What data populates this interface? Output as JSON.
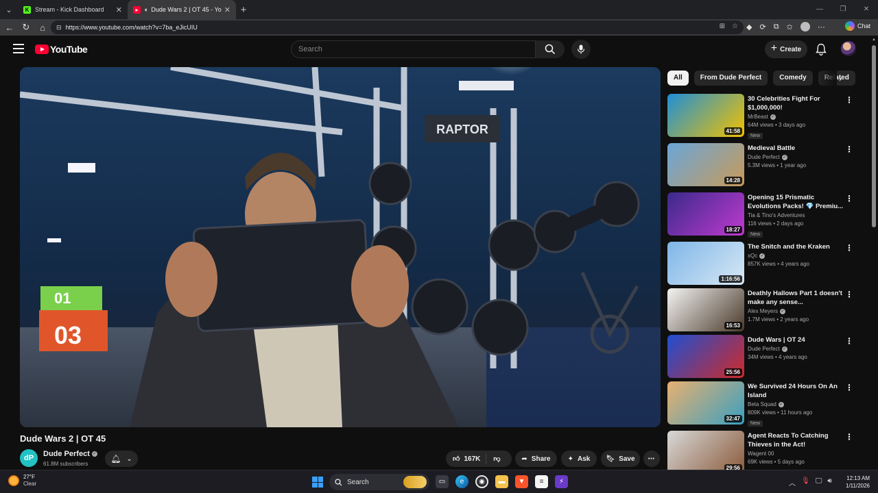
{
  "browser": {
    "tabs": [
      {
        "title": "Stream - Kick Dashboard",
        "favicon": "kick-icon",
        "active": false
      },
      {
        "title": "Dude Wars 2 | OT 45 - YouTube",
        "favicon": "youtube-icon",
        "active": true
      }
    ],
    "url": "https://www.youtube.com/watch?v=7ba_eJicUIU",
    "chat_label": "Chat"
  },
  "masthead": {
    "logo_text": "YouTube",
    "search_placeholder": "Search",
    "create_label": "Create"
  },
  "video": {
    "title": "Dude Wars 2 | OT 45",
    "channel": "Dude Perfect",
    "subscribers": "61.8M subscribers",
    "likes": "167K",
    "share_label": "Share",
    "ask_label": "Ask",
    "save_label": "Save"
  },
  "chips": [
    "All",
    "From Dude Perfect",
    "Comedy",
    "Related"
  ],
  "recommendations": [
    {
      "title": "30 Celebrities Fight For $1,000,000!",
      "channel": "MrBeast",
      "verified": true,
      "meta": "64M views • 3 days ago",
      "duration": "41:58",
      "is_new": true,
      "new_label": "New",
      "thumb_colors": [
        "#1f8fd6",
        "#f2c200"
      ]
    },
    {
      "title": "Medieval Battle",
      "channel": "Dude Perfect",
      "verified": true,
      "meta": "5.3M views • 1 year ago",
      "duration": "14:28",
      "is_new": false,
      "new_label": "",
      "thumb_colors": [
        "#6aa6d8",
        "#c89a5a"
      ]
    },
    {
      "title": "Opening 15 Prismatic Evolutions Packs! 💎 Premiu...",
      "channel": "Tia & Tino's Adventures",
      "verified": false,
      "meta": "116 views • 2 days ago",
      "duration": "18:27",
      "is_new": true,
      "new_label": "New",
      "thumb_colors": [
        "#3a2a8a",
        "#c03ad0"
      ]
    },
    {
      "title": "The Snitch and the Kraken",
      "channel": "xQc",
      "verified": true,
      "meta": "857K views • 4 years ago",
      "duration": "1:16:56",
      "is_new": false,
      "new_label": "",
      "thumb_colors": [
        "#7fb6e8",
        "#d8e8f5"
      ]
    },
    {
      "title": "Deathly Hallows Part 1 doesn't make any sense...",
      "channel": "Alex Meyers",
      "verified": true,
      "meta": "1.7M views • 2 years ago",
      "duration": "16:53",
      "is_new": false,
      "new_label": "",
      "thumb_colors": [
        "#f4f4f4",
        "#4a3a2a"
      ]
    },
    {
      "title": "Dude Wars | OT 24",
      "channel": "Dude Perfect",
      "verified": true,
      "meta": "34M views • 4 years ago",
      "duration": "25:56",
      "is_new": false,
      "new_label": "",
      "thumb_colors": [
        "#1e4fd0",
        "#d02a2a"
      ]
    },
    {
      "title": "We Survived 24 Hours On An Island",
      "channel": "Beta Squad",
      "verified": true,
      "meta": "809K views • 11 hours ago",
      "duration": "32:47",
      "is_new": true,
      "new_label": "New",
      "thumb_colors": [
        "#e8b070",
        "#3aa0c0"
      ]
    },
    {
      "title": "Agent Reacts To Catching Thieves in the Act!",
      "channel": "Wagent 00",
      "verified": false,
      "meta": "69K views • 5 days ago",
      "duration": "29:56",
      "is_new": false,
      "new_label": "",
      "thumb_colors": [
        "#d8d8d8",
        "#8a5a3a"
      ]
    }
  ],
  "taskbar": {
    "weather_temp": "27°F",
    "weather_desc": "Clear",
    "search_label": "Search",
    "time": "12:13 AM",
    "date": "1/11/2026"
  }
}
